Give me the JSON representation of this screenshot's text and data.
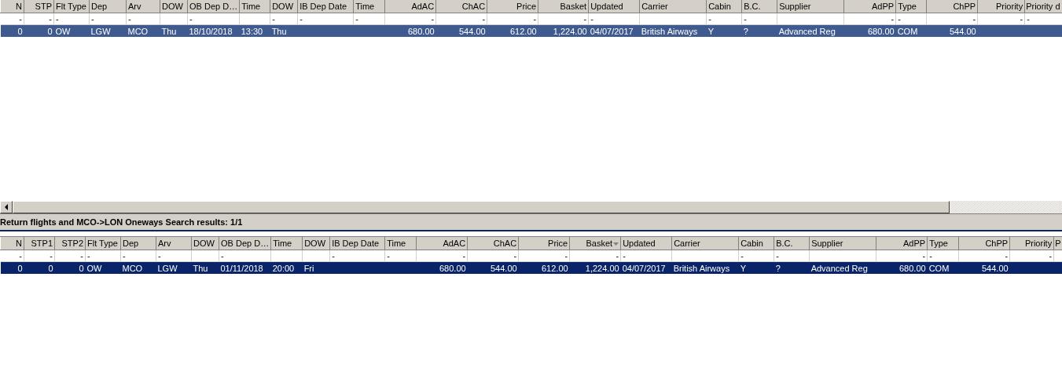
{
  "top_grid": {
    "focused": false,
    "columns": [
      {
        "label": "N",
        "filter": "-"
      },
      {
        "label": "STP",
        "filter": "-"
      },
      {
        "label": "Flt Type",
        "filter": "-"
      },
      {
        "label": "Dep",
        "filter": "-"
      },
      {
        "label": "Arv",
        "filter": "-"
      },
      {
        "label": "DOW"
      },
      {
        "label": "OB Dep D…",
        "filter": "-"
      },
      {
        "label": "Time"
      },
      {
        "label": "DOW",
        "filter": "-"
      },
      {
        "label": "IB Dep Date",
        "filter": "-"
      },
      {
        "label": "Time",
        "filter": "-"
      },
      {
        "label": "AdAC",
        "filter": "-"
      },
      {
        "label": "ChAC",
        "filter": "-"
      },
      {
        "label": "Price",
        "filter": "-"
      },
      {
        "label": "Basket",
        "filter": "-"
      },
      {
        "label": "Updated",
        "filter": "-"
      },
      {
        "label": "Carrier"
      },
      {
        "label": "Cabin",
        "filter": "-"
      },
      {
        "label": "B.C.",
        "filter": "-"
      },
      {
        "label": "Supplier"
      },
      {
        "label": "AdPP",
        "filter": "-"
      },
      {
        "label": "Type",
        "filter": "-"
      },
      {
        "label": "ChPP",
        "filter": "-"
      },
      {
        "label": "Priority",
        "filter": "-"
      },
      {
        "label": "Priority d",
        "filter": "-"
      }
    ],
    "rows": [
      {
        "selected": true,
        "cells": [
          {
            "text": "0"
          },
          {
            "text": "0"
          },
          {
            "text": "OW"
          },
          {
            "text": "LGW"
          },
          {
            "text": "MCO"
          },
          {
            "text": "Thu"
          },
          {
            "text": "18/10/2018"
          },
          {
            "text": "13:30"
          },
          {
            "text": "Thu"
          },
          {},
          {},
          {
            "text": "680.00"
          },
          {
            "text": "544.00"
          },
          {
            "text": "612.00"
          },
          {
            "text": "1,224.00"
          },
          {
            "text": "04/07/2017"
          },
          {
            "text": "British Airways"
          },
          {
            "text": "Y"
          },
          {
            "text": "?"
          },
          {
            "text": "Advanced Reg"
          },
          {
            "text": "680.00"
          },
          {
            "text": "COM"
          },
          {
            "text": "544.00"
          },
          {},
          {}
        ]
      }
    ]
  },
  "group_title": "Return flights and MCO->LON Oneways Search results: 1/1",
  "bottom_grid": {
    "focused": true,
    "columns": [
      {
        "label": "N",
        "filter": "-"
      },
      {
        "label": "STP1",
        "filter": "-"
      },
      {
        "label": "STP2",
        "filter": "-"
      },
      {
        "label": "Flt Type",
        "filter": "-"
      },
      {
        "label": "Dep",
        "filter": "-"
      },
      {
        "label": "Arv",
        "filter": "-"
      },
      {
        "label": "DOW"
      },
      {
        "label": "OB Dep D…",
        "filter": "-"
      },
      {
        "label": "Time"
      },
      {
        "label": "DOW"
      },
      {
        "label": "IB Dep Date",
        "filter": "-"
      },
      {
        "label": "Time",
        "filter": "-"
      },
      {
        "label": "AdAC",
        "filter": "-"
      },
      {
        "label": "ChAC",
        "filter": "-"
      },
      {
        "label": "Price",
        "filter": "-"
      },
      {
        "label": "Basket",
        "filter": "-",
        "sorted_descending": true
      },
      {
        "label": "Updated",
        "filter": "-"
      },
      {
        "label": "Carrier"
      },
      {
        "label": "Cabin",
        "filter": "-"
      },
      {
        "label": "B.C.",
        "filter": "-"
      },
      {
        "label": "Supplier"
      },
      {
        "label": "AdPP",
        "filter": "-"
      },
      {
        "label": "Type",
        "filter": "-"
      },
      {
        "label": "ChPP",
        "filter": "-"
      },
      {
        "label": "Priority",
        "filter": "-"
      },
      {
        "label": "P"
      }
    ],
    "rows": [
      {
        "selected": true,
        "cells": [
          {
            "text": "0"
          },
          {
            "text": "0"
          },
          {
            "text": "0"
          },
          {
            "text": "OW"
          },
          {
            "text": "MCO"
          },
          {
            "text": "LGW"
          },
          {
            "text": "Thu"
          },
          {
            "text": "01/11/2018"
          },
          {
            "text": "20:00"
          },
          {
            "text": "Fri"
          },
          {},
          {},
          {
            "text": "680.00"
          },
          {
            "text": "544.00"
          },
          {
            "text": "612.00"
          },
          {
            "text": "1,224.00"
          },
          {
            "text": "04/07/2017"
          },
          {
            "text": "British Airways"
          },
          {
            "text": "Y"
          },
          {
            "text": "?"
          },
          {
            "text": "Advanced Reg"
          },
          {
            "text": "680.00"
          },
          {
            "text": "COM"
          },
          {
            "text": "544.00"
          },
          {},
          {}
        ]
      }
    ]
  }
}
